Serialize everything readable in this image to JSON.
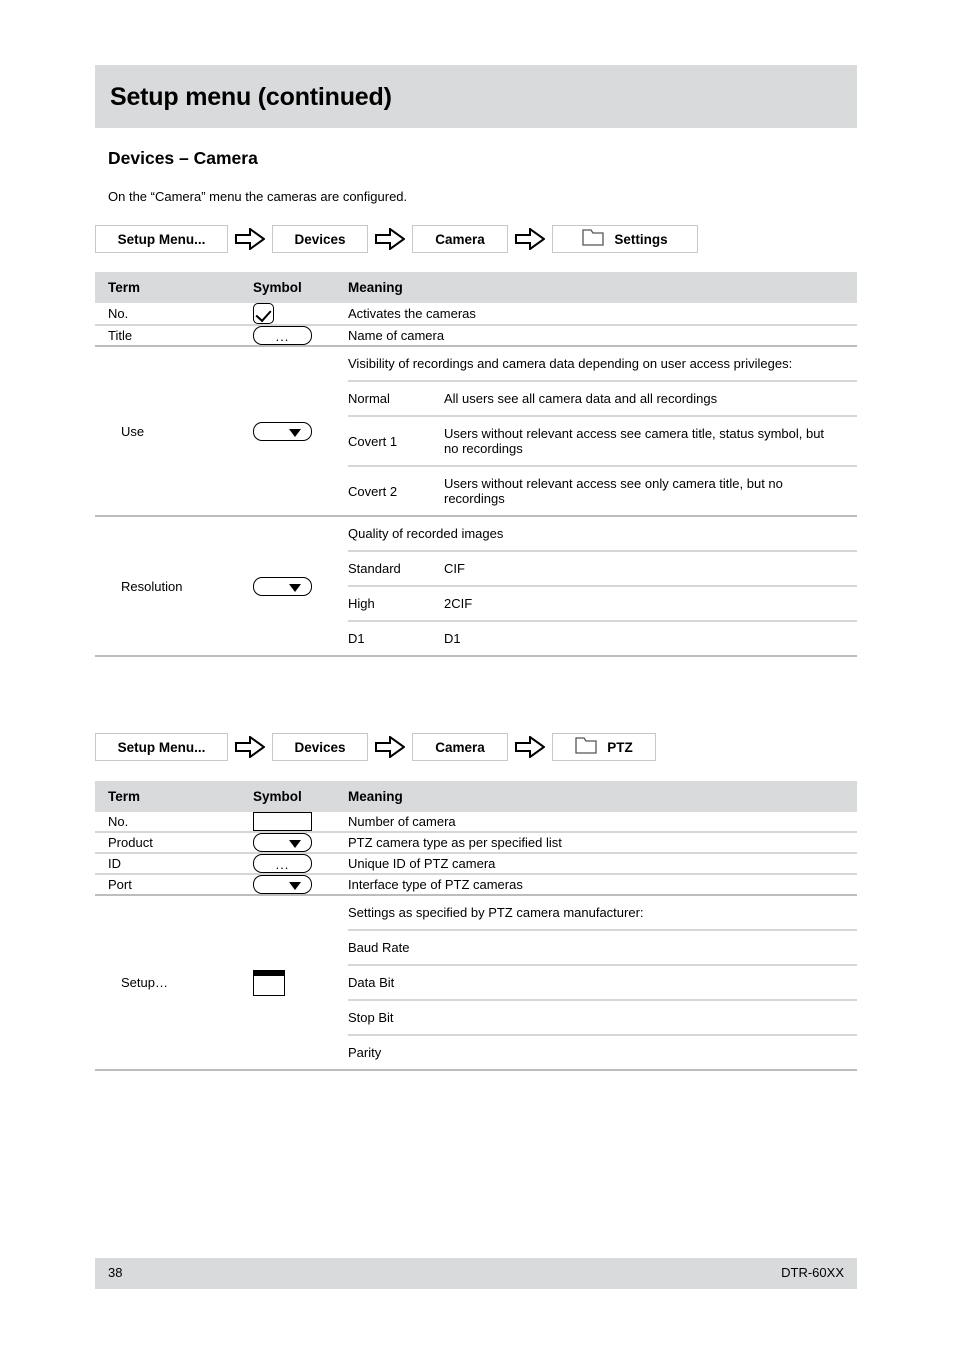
{
  "header": {
    "title": "Setup menu (continued)"
  },
  "section": {
    "heading": "Devices – Camera",
    "intro": "On the “Camera” menu the cameras are configured."
  },
  "breadcrumb_settings": {
    "items": [
      {
        "label": "Setup Menu...",
        "icon": null
      },
      {
        "label": "Devices",
        "icon": null
      },
      {
        "label": "Camera",
        "icon": null
      },
      {
        "label": "Settings",
        "icon": "folder-icon"
      }
    ],
    "separator": "arrow-right-icon"
  },
  "breadcrumb_ptz": {
    "items": [
      {
        "label": "Setup Menu...",
        "icon": null
      },
      {
        "label": "Devices",
        "icon": null
      },
      {
        "label": "Camera",
        "icon": null
      },
      {
        "label": "PTZ",
        "icon": "folder-icon"
      }
    ],
    "separator": "arrow-right-icon"
  },
  "table_settings": {
    "columns": [
      "Term",
      "Symbol",
      "Meaning"
    ],
    "rows": [
      {
        "term": "No.",
        "symbol": "checkbox",
        "meaning": "Activates the cameras"
      },
      {
        "term": "Title",
        "symbol": "ellipsis-button",
        "meaning": "Name of camera"
      },
      {
        "term": "Use",
        "symbol": "dropdown",
        "meaning_intro": "Visibility of recordings and camera data depending on user access privileges:",
        "sub_rows": [
          {
            "key": "Normal",
            "value": "All users see all camera data and all recordings"
          },
          {
            "key": "Covert 1",
            "value": "Users without relevant access see camera title, status symbol, but no recordings"
          },
          {
            "key": "Covert 2",
            "value": "Users without relevant access see only camera title, but no recordings"
          }
        ]
      },
      {
        "term": "Resolution",
        "symbol": "dropdown",
        "meaning_intro": "Quality of recorded images",
        "sub_rows": [
          {
            "key": "Standard",
            "value": "CIF"
          },
          {
            "key": "High",
            "value": "2CIF"
          },
          {
            "key": "D1",
            "value": "D1"
          }
        ]
      }
    ]
  },
  "table_ptz": {
    "columns": [
      "Term",
      "Symbol",
      "Meaning"
    ],
    "rows": [
      {
        "term": "No.",
        "symbol": "textbox",
        "meaning": "Number of camera"
      },
      {
        "term": "Product",
        "symbol": "dropdown",
        "meaning": "PTZ camera type as per specified list"
      },
      {
        "term": "ID",
        "symbol": "ellipsis-button",
        "meaning": "Unique ID of PTZ camera"
      },
      {
        "term": "Port",
        "symbol": "dropdown",
        "meaning": "Interface type of PTZ cameras"
      },
      {
        "term": "Setup…",
        "symbol": "window",
        "meaning_intro": "Settings as specified by PTZ camera manufacturer:",
        "sub_rows": [
          {
            "key": "Baud Rate",
            "value": ""
          },
          {
            "key": "Data Bit",
            "value": ""
          },
          {
            "key": "Stop Bit",
            "value": ""
          },
          {
            "key": "Parity",
            "value": ""
          }
        ]
      }
    ]
  },
  "footer": {
    "page_number": "38",
    "model": "DTR-60XX"
  },
  "colors": {
    "banner_gray": "#d9dadc",
    "rule_gray": "#d6d6d6",
    "text": "#000000"
  }
}
